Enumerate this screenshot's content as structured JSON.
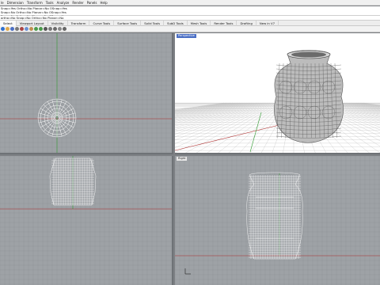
{
  "menu": [
    "le",
    "Dimension",
    "Transform",
    "Tools",
    "Analyze",
    "Render",
    "Panels",
    "Help"
  ],
  "history": [
    "Snap=Yes Ortho=No Planar=No OSnap=Yes",
    "Snap=No Ortho=No Planar=No OSnap=Yes",
    "Snap=No Ortho=No Planar=No OSnap=Yes"
  ],
  "command_line": "ortho=No  Snap=No  Ortho=No  Planar=No",
  "tabs": [
    "Select",
    "Viewport Layout",
    "Visibility",
    "Transform",
    "Curve Tools",
    "Surface Tools",
    "Solid Tools",
    "SubD Tools",
    "Mesh Tools",
    "Render Tools",
    "Drafting",
    "New in V7"
  ],
  "toolbar_icons": [
    {
      "name": "new-file-icon",
      "color": "#2f6fce"
    },
    {
      "name": "open-icon",
      "color": "#e0a84a"
    },
    {
      "name": "save-icon",
      "color": "#4b6fc4"
    },
    {
      "name": "print-icon",
      "color": "#777777"
    },
    {
      "name": "cut-icon",
      "color": "#aa4444"
    },
    {
      "name": "copy-icon",
      "color": "#6a8fd0"
    },
    {
      "name": "paste-icon",
      "color": "#c09050"
    },
    {
      "name": "undo-icon",
      "color": "#4a9a4a"
    },
    {
      "name": "redo-icon",
      "color": "#4a9a4a"
    },
    {
      "name": "pan-icon",
      "color": "#555555"
    },
    {
      "name": "rotate-icon",
      "color": "#777777"
    },
    {
      "name": "zoom-icon",
      "color": "#6a6a6a"
    },
    {
      "name": "zoom-window-icon",
      "color": "#888888"
    },
    {
      "name": "zoom-extents-icon",
      "color": "#666666"
    }
  ],
  "viewports": {
    "perspective": {
      "title": "Perspective"
    },
    "right": {
      "title": "Right"
    }
  },
  "colors": {
    "viewport_bg": "#9ea2a6",
    "grid_line": "#8e9296",
    "x_axis": "#b03030",
    "y_axis": "#2f9a2f",
    "active_tab": "#4b6fc4",
    "wire": "#ffffff"
  }
}
